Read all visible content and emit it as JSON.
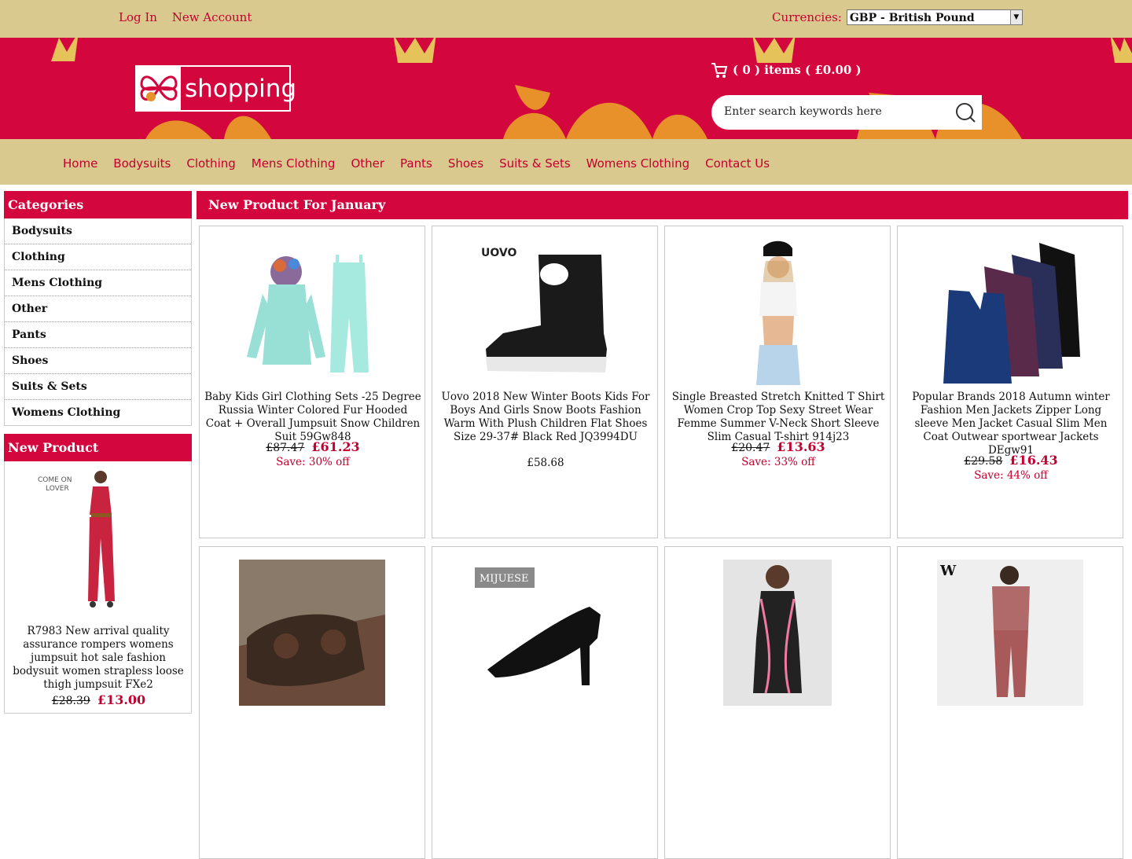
{
  "header": {
    "login_label": "Log In",
    "new_account_label": "New Account",
    "currencies_label": "Currencies:",
    "currency_selected": "GBP - British Pound",
    "logo_text": "shopping",
    "cart_text": "( 0 ) items ( £0.00 )",
    "search_placeholder": "Enter search keywords here"
  },
  "nav": [
    "Home",
    "Bodysuits",
    "Clothing",
    "Mens Clothing",
    "Other",
    "Pants",
    "Shoes",
    "Suits & Sets",
    "Womens Clothing",
    "Contact Us"
  ],
  "sidebar": {
    "categories_title": "Categories",
    "categories": [
      "Bodysuits",
      "Clothing",
      "Mens Clothing",
      "Other",
      "Pants",
      "Shoes",
      "Suits & Sets",
      "Womens Clothing"
    ],
    "new_product_title": "New Product",
    "new_product": {
      "name": "R7983 New arrival quality assurance rompers womens jumpsuit hot sale fashion bodysuit women strapless loose thigh jumpsuit FXe2",
      "old_price": "£28.39",
      "price": "£13.00",
      "image_text": "COME ON LOVER"
    }
  },
  "main": {
    "title": "New Product For January",
    "products": [
      {
        "name": "Baby Kids Girl Clothing Sets -25 Degree Russia Winter Colored Fur Hooded Coat + Overall Jumpsuit Snow Children Suit 59Gw848",
        "old_price": "£87.47",
        "price": "£61.23",
        "save": "Save: 30% off"
      },
      {
        "name": "Uovo 2018 New Winter Boots Kids For Boys And Girls Snow Boots Fashion Warm With Plush Children Flat Shoes Size 29-37# Black Red JQ3994DU",
        "price": "£58.68",
        "image_text": "UOVO"
      },
      {
        "name": "Single Breasted Stretch Knitted T Shirt Women Crop Top Sexy Street Wear Femme Summer V-Neck Short Sleeve Slim Casual T-shirt 914j23",
        "old_price": "£20.47",
        "price": "£13.63",
        "save": "Save: 33% off"
      },
      {
        "name": "Popular Brands 2018 Autumn winter Fashion Men Jackets Zipper Long sleeve Men Jacket Casual Slim Men Coat Outwear sportwear Jackets DEgw91",
        "old_price": "£29.58",
        "price": "£16.43",
        "save": "Save: 44% off"
      },
      {
        "name": ""
      },
      {
        "name": "",
        "image_text": "MIJUESE"
      },
      {
        "name": ""
      },
      {
        "name": "",
        "image_text": "W"
      }
    ]
  }
}
